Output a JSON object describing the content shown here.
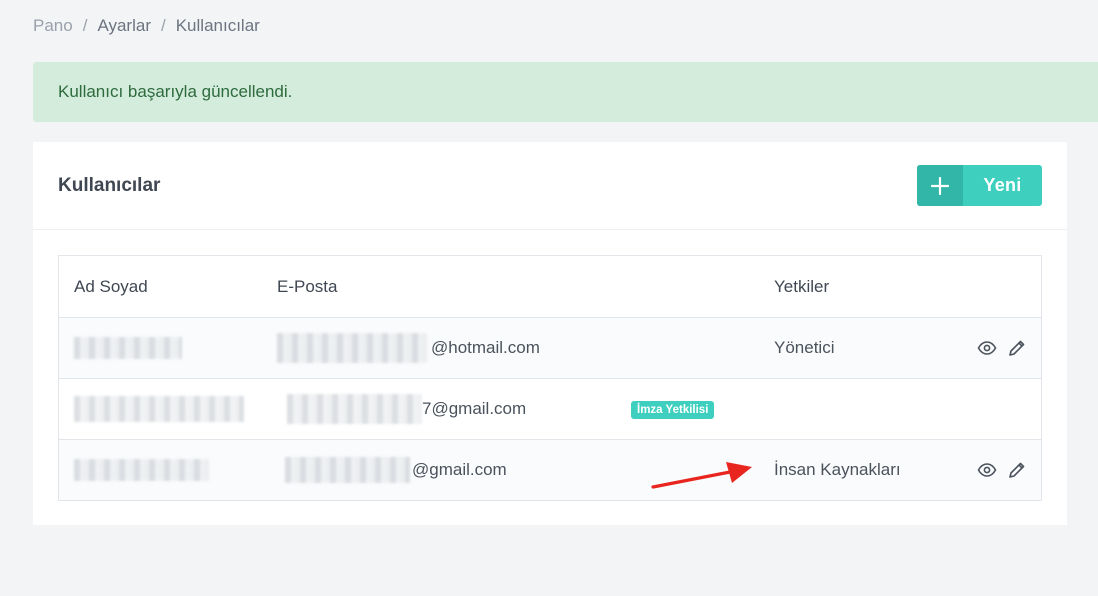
{
  "breadcrumb": [
    "Pano",
    "Ayarlar",
    "Kullanıcılar"
  ],
  "alert": {
    "message": "Kullanıcı başarıyla güncellendi."
  },
  "card": {
    "title": "Kullanıcılar",
    "new_button": {
      "icon": "plus-icon",
      "label": "Yeni"
    }
  },
  "table": {
    "headers": [
      "Ad Soyad",
      "E-Posta",
      "Yetkiler"
    ],
    "rows": [
      {
        "email_suffix": "@hotmail.com",
        "permission": "Yönetici",
        "badge": "",
        "actions": [
          "eye-icon",
          "pencil-icon"
        ]
      },
      {
        "email_suffix": "7@gmail.com",
        "permission": "",
        "badge": "İmza Yetkilisi",
        "actions": []
      },
      {
        "email_suffix": "@gmail.com",
        "permission": "İnsan Kaynakları",
        "badge": "",
        "actions": [
          "eye-icon",
          "pencil-icon"
        ]
      }
    ]
  },
  "colors": {
    "accent": "#3ecfbf",
    "alert_bg": "#d4ecdb",
    "alert_text": "#2e6b3e",
    "arrow": "#e8261f"
  }
}
